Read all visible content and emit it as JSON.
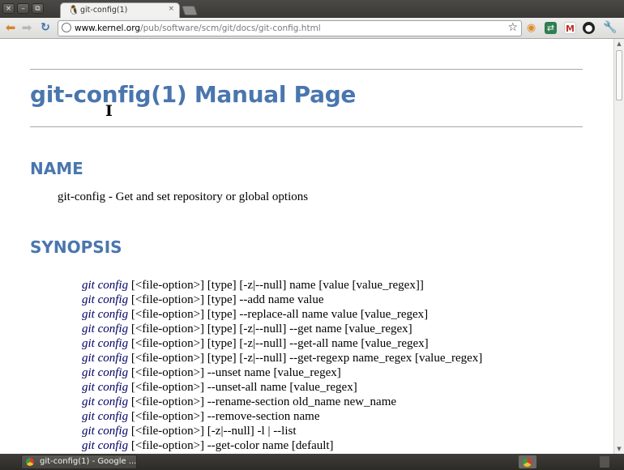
{
  "window": {
    "controls": {
      "close": "×",
      "minimize": "–",
      "maximize": "⧉"
    }
  },
  "tab": {
    "title": "git-config(1)",
    "icon": "tux-icon",
    "close": "×"
  },
  "toolbar": {
    "back_icon": "arrow-left-icon",
    "forward_icon": "arrow-right-icon",
    "reload_icon": "reload-icon",
    "url_host": "www.kernel.org",
    "url_path": "/pub/software/scm/git/docs/git-config.html",
    "bookmark_icon": "star-icon",
    "extensions": [
      "rss-icon",
      "translate-icon",
      "gmail-icon",
      "camera-icon",
      "wrench-icon"
    ]
  },
  "page": {
    "title": "git-config(1) Manual Page",
    "name_heading": "NAME",
    "name_description": "git-config - Get and set repository or global options",
    "synopsis_heading": "SYNOPSIS",
    "synopsis": [
      {
        "cmd": "git config",
        "args": " [<file-option>] [type] [-z|--null] name [value [value_regex]]"
      },
      {
        "cmd": "git config",
        "args": " [<file-option>] [type] --add name value"
      },
      {
        "cmd": "git config",
        "args": " [<file-option>] [type] --replace-all name value [value_regex]"
      },
      {
        "cmd": "git config",
        "args": " [<file-option>] [type] [-z|--null] --get name [value_regex]"
      },
      {
        "cmd": "git config",
        "args": " [<file-option>] [type] [-z|--null] --get-all name [value_regex]"
      },
      {
        "cmd": "git config",
        "args": " [<file-option>] [type] [-z|--null] --get-regexp name_regex [value_regex]"
      },
      {
        "cmd": "git config",
        "args": " [<file-option>] --unset name [value_regex]"
      },
      {
        "cmd": "git config",
        "args": " [<file-option>] --unset-all name [value_regex]"
      },
      {
        "cmd": "git config",
        "args": " [<file-option>] --rename-section old_name new_name"
      },
      {
        "cmd": "git config",
        "args": " [<file-option>] --remove-section name"
      },
      {
        "cmd": "git config",
        "args": " [<file-option>] [-z|--null] -l | --list"
      },
      {
        "cmd": "git config",
        "args": " [<file-option>] --get-color name [default]"
      }
    ]
  },
  "taskbar": {
    "item_label": "git-config(1) - Google ...",
    "item_icon": "chrome-icon"
  },
  "colors": {
    "heading": "#4a76ae",
    "command": "#000066",
    "rule": "#a8a8a8"
  }
}
